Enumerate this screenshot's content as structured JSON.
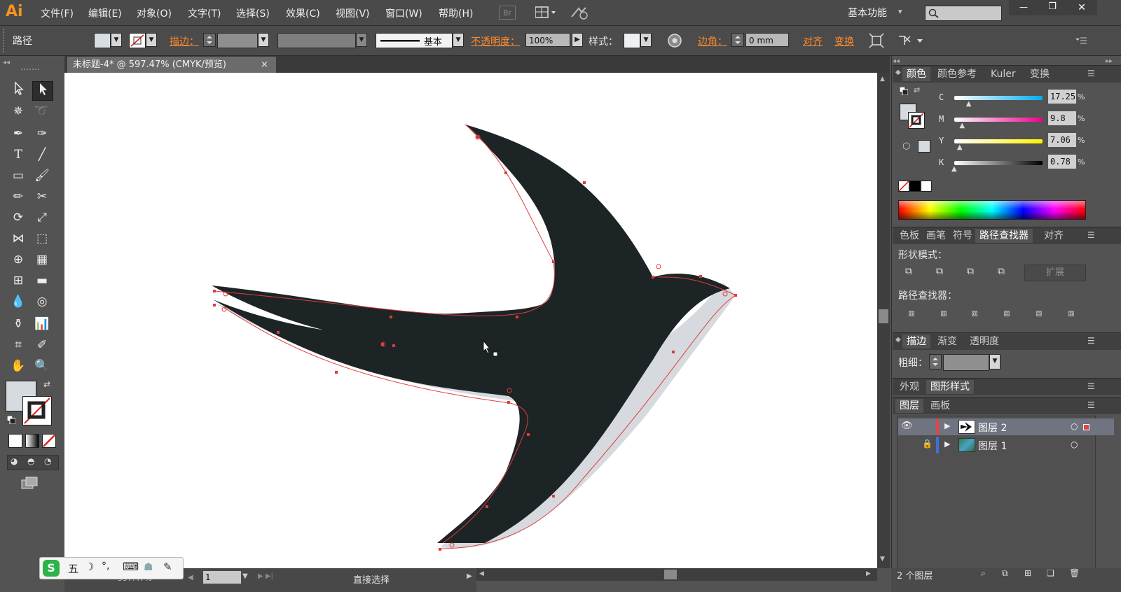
{
  "app": {
    "logo": "Ai"
  },
  "menu": [
    "文件(F)",
    "编辑(E)",
    "对象(O)",
    "文字(T)",
    "选择(S)",
    "效果(C)",
    "视图(V)",
    "窗口(W)",
    "帮助(H)"
  ],
  "menu_icons": {
    "bridge": "Br"
  },
  "workspace": {
    "label": "基本功能",
    "chevron": "▾"
  },
  "window_controls": {
    "minimize": "—",
    "restore": "❐",
    "close": "✕"
  },
  "control": {
    "object_type": "路径",
    "stroke_label": "描边：",
    "stroke_profile": "基本",
    "opacity_label": "不透明度：",
    "opacity_value": "100%",
    "style_label": "样式：",
    "corner_label": "边角：",
    "corner_value": "0 mm",
    "align_label": "对齐",
    "transform_label": "变换"
  },
  "document": {
    "tab_title": "未标题-4* @ 597.47% (CMYK/预览)",
    "close": "×"
  },
  "status": {
    "zoom": "597.47%",
    "artboard": "1",
    "tool": "直接选择"
  },
  "color_panel": {
    "tabs": [
      "颜色",
      "颜色参考",
      "Kuler",
      "变换"
    ],
    "channels": [
      {
        "name": "C",
        "value": "17.25",
        "unit": "%",
        "fraction": 0.1725
      },
      {
        "name": "M",
        "value": "9.8",
        "unit": "%",
        "fraction": 0.098
      },
      {
        "name": "Y",
        "value": "7.06",
        "unit": "%",
        "fraction": 0.0706
      },
      {
        "name": "K",
        "value": "0.78",
        "unit": "%",
        "fraction": 0.0078
      }
    ],
    "fill_color": "#d3d9de"
  },
  "pathfinder_panel": {
    "tabs": [
      "色板",
      "画笔",
      "符号",
      "路径查找器",
      "对齐"
    ],
    "shape_modes_label": "形状模式：",
    "expand_label": "扩展",
    "pathfinders_label": "路径查找器："
  },
  "stroke_panel": {
    "tabs": [
      "描边",
      "渐变",
      "透明度"
    ],
    "weight_label": "粗细："
  },
  "appearance_panel": {
    "tabs": [
      "外观",
      "图形样式"
    ]
  },
  "layers_panel": {
    "tabs": [
      "图层",
      "画板"
    ],
    "layers": [
      {
        "name": "图层 2",
        "color": "#e04646"
      },
      {
        "name": "图层 1",
        "color": "#3f6fd8"
      }
    ],
    "count_label": "2 个图层"
  },
  "ime": {
    "brand": "S",
    "mode": "五",
    "moon": "☽",
    "punct": "°,",
    "keyboard": "⌨",
    "user": "☗",
    "wrench": "✎"
  },
  "colors": {
    "accent_orange": "#ff8a2a",
    "art_fill": "#1c2426",
    "art_shadow": "#d6dade",
    "path_red": "#e23b3b"
  }
}
